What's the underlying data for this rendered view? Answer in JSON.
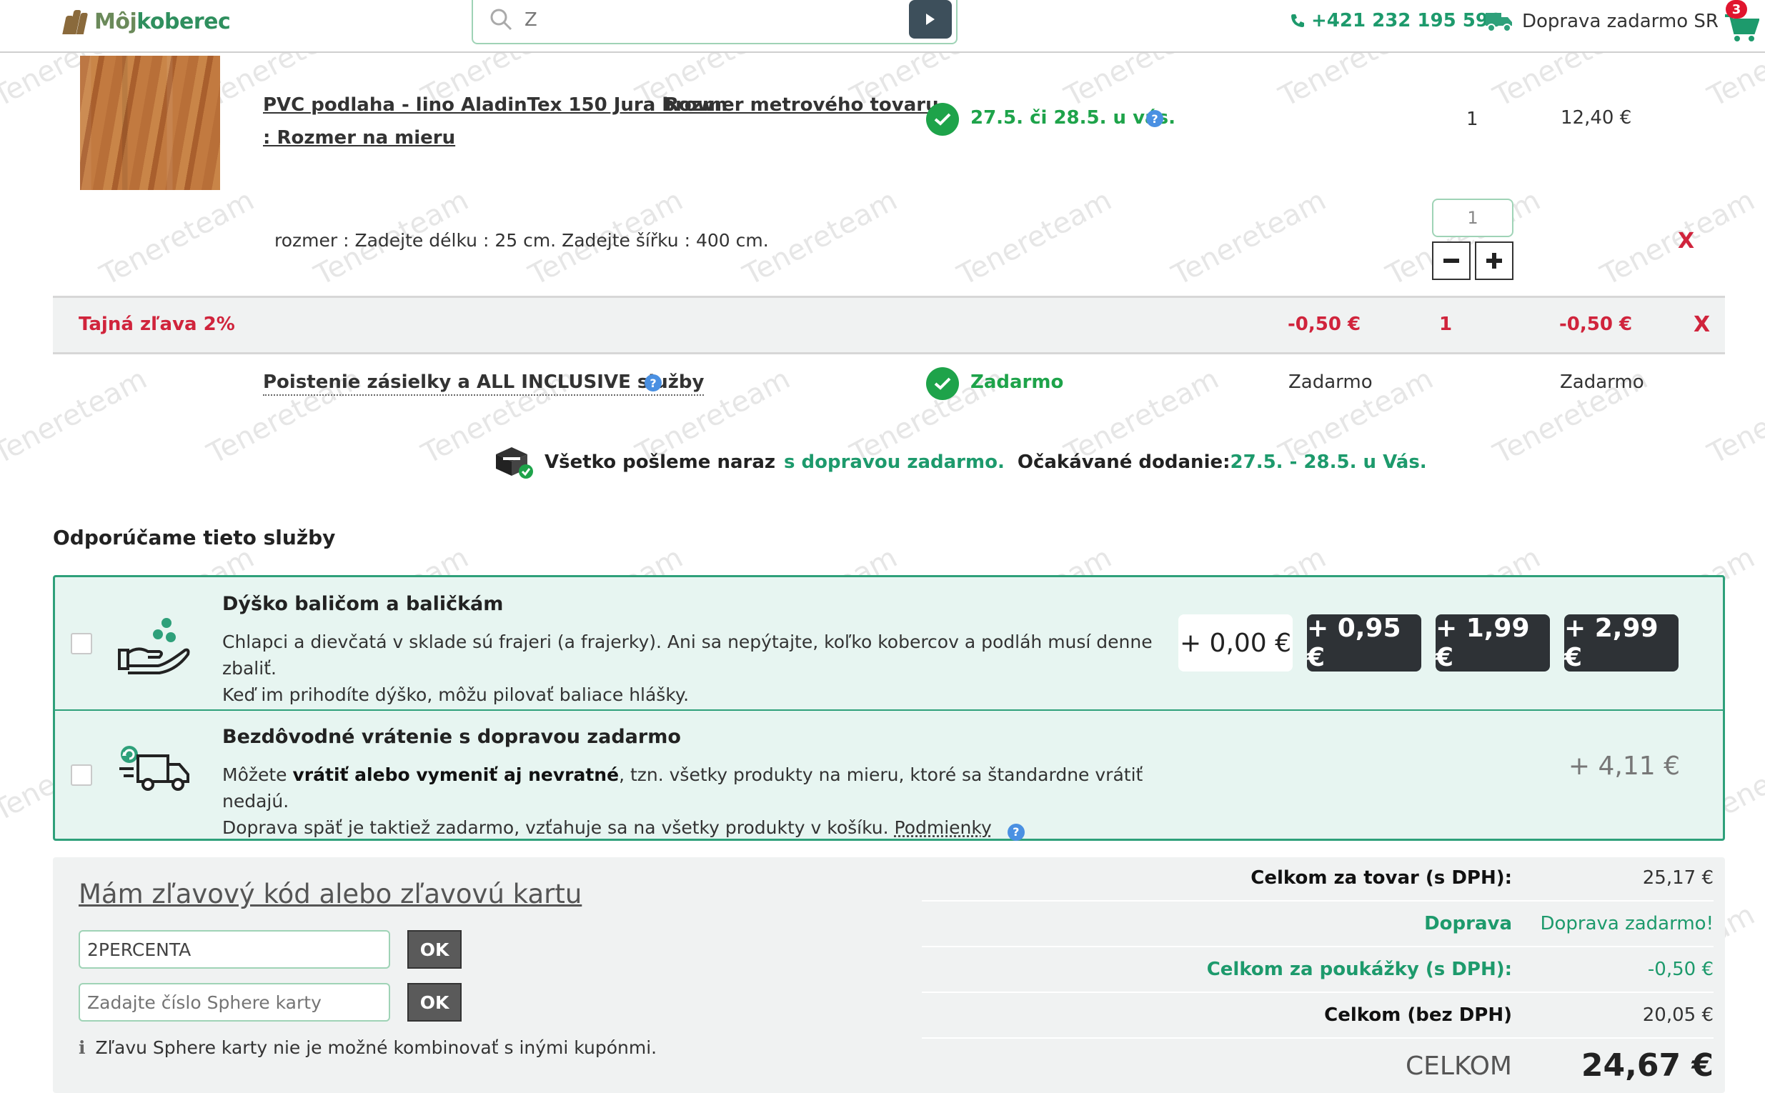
{
  "header": {
    "logo_part1": "Môj",
    "logo_part2": "koberec",
    "search_value": "Z",
    "phone": "+421 232 195 596",
    "shipping": "Doprava zadarmo SR",
    "cart_count": "3"
  },
  "product": {
    "title": "PVC podlaha - lino AladinTex 150 Jura brown",
    "size_label": "Rozmer metrového tovaru",
    "size_value": ": Rozmer na mieru",
    "delivery": "27.5. či 28.5. u vás.",
    "quantity": "1",
    "price": "12,40 €",
    "attributes": "rozmer : Zadejte délku : 25 cm. Zadejte šířku : 400 cm.",
    "qty_input": "1",
    "remove": "X"
  },
  "discount": {
    "label": "Tajná zľava 2%",
    "unit_price": "-0,50 €",
    "quantity": "1",
    "total": "-0,50 €",
    "remove": "X"
  },
  "insurance": {
    "label": "Poistenie zásielky a ALL INCLUSIVE služby",
    "status": "Zadarmo",
    "unit_price": "Zadarmo",
    "total": "Zadarmo"
  },
  "delivery_note": {
    "part1": "Všetko pošleme naraz",
    "part2": "s dopravou zadarmo.",
    "part3": "Očakávané dodanie:",
    "part4": "27.5. - 28.5. u Vás."
  },
  "services": {
    "heading": "Odporúčame tieto služby",
    "tip": {
      "title": "Dýško baličom a baličkám",
      "desc_line1": "Chlapci a dievčatá v sklade sú frajeri (a frajerky). Ani sa nepýtajte, koľko kobercov a podláh musí denne zbaliť.",
      "desc_line2": "Keď im prihodíte dýško, môžu pilovať baliace hlášky.",
      "options": [
        "+ 0,00 €",
        "+ 0,95 €",
        "+ 1,99 €",
        "+ 2,99 €"
      ]
    },
    "return": {
      "title": "Bezdôvodné vrátenie s dopravou zadarmo",
      "desc_a": "Môžete ",
      "desc_b": "vrátiť alebo vymeniť aj nevratné",
      "desc_c": ", tzn. všetky produkty na mieru, ktoré sa štandardne vrátiť nedajú.",
      "desc_line2": "Doprava späť je taktiež zadarmo, vzťahuje sa na všetky produkty v košíku. ",
      "link": "Podmienky",
      "price": "+ 4,11 €"
    }
  },
  "coupon": {
    "title": "Mám zľavový kód alebo zľavovú kartu",
    "code_value": "2PERCENTA",
    "ok": "OK",
    "sphere_placeholder": "Zadajte číslo Sphere karty",
    "note": "Zľavu Sphere karty nie je možné kombinovať s inými kupónmi."
  },
  "totals": [
    {
      "label": "Celkom za tovar (s DPH):",
      "value": "25,17 €"
    },
    {
      "label": "Doprava",
      "value": "Doprava zadarmo!"
    },
    {
      "label": "Celkom za poukážky (s DPH):",
      "value": "-0,50 €"
    },
    {
      "label": "Celkom (bez DPH)",
      "value": "20,05 €"
    },
    {
      "label": "CELKOM",
      "value": "24,67 €"
    }
  ],
  "watermark": "Tenereteam",
  "colors": {
    "accent_green": "#1d9a6c",
    "discount_red": "#d0243c",
    "service_bg": "#e7f5f1"
  }
}
